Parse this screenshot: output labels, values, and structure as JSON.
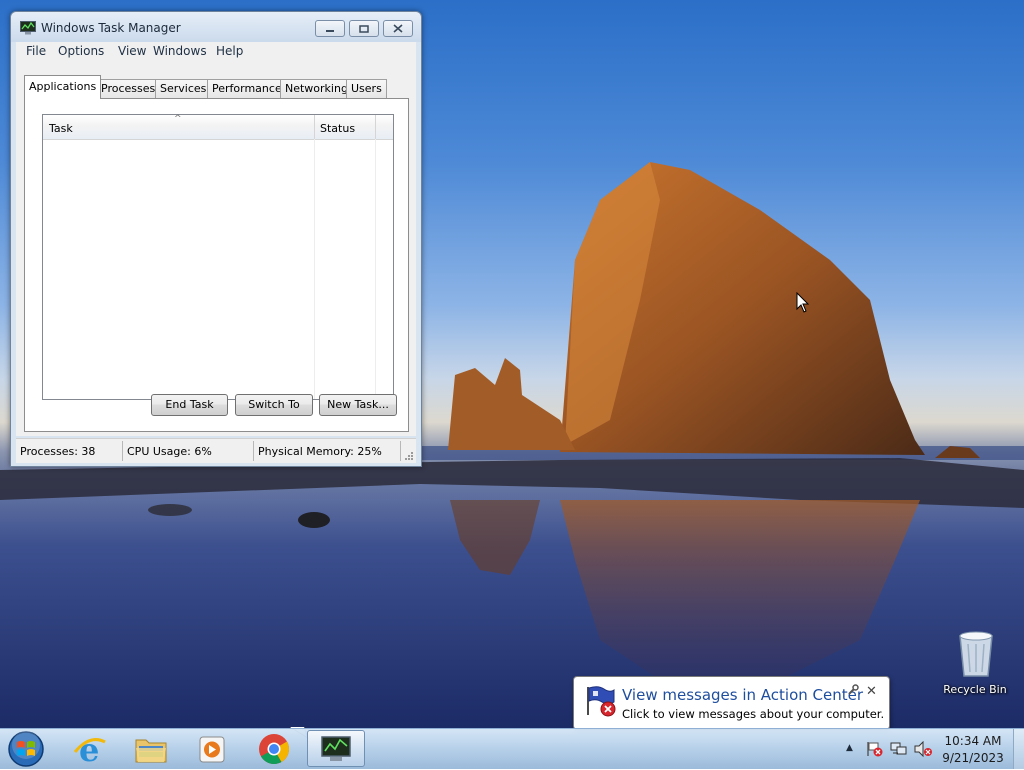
{
  "window": {
    "title": "Windows Task Manager",
    "menu": [
      "File",
      "Options",
      "View",
      "Windows",
      "Help"
    ],
    "tabs": [
      "Applications",
      "Processes",
      "Services",
      "Performance",
      "Networking",
      "Users"
    ],
    "active_tab": "Applications",
    "list": {
      "columns": [
        "Task",
        "Status"
      ],
      "rows": []
    },
    "buttons": {
      "end_task": "End Task",
      "switch_to": "Switch To",
      "new_task": "New Task..."
    },
    "status": {
      "processes": "Processes: 38",
      "cpu": "CPU Usage: 6%",
      "memory": "Physical Memory: 25%"
    }
  },
  "desktop": {
    "recycle_bin_label": "Recycle Bin"
  },
  "notification": {
    "title": "View messages in Action Center",
    "text": "Click to view messages about your computer."
  },
  "taskbar": {
    "pinned": [
      "start-orb",
      "internet-explorer-icon",
      "file-explorer-icon",
      "media-player-icon",
      "chrome-icon",
      "task-manager-icon"
    ],
    "clock": {
      "time": "10:34 AM",
      "date": "9/21/2023"
    }
  }
}
